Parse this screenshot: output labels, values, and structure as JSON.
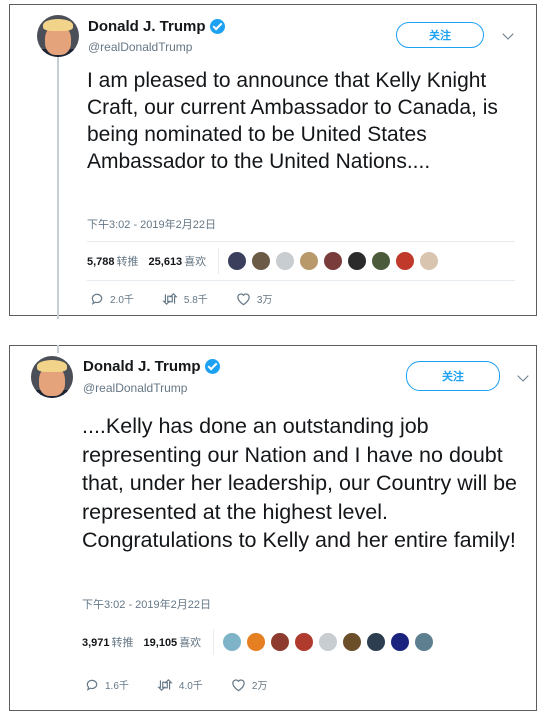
{
  "tweets": [
    {
      "name": "Donald J. Trump",
      "handle": "@realDonaldTrump",
      "follow_label": "关注",
      "text": "I am pleased to announce that Kelly Knight Craft, our current Ambassador to Canada, is being nominated to be United States Ambassador to the United Nations....",
      "timestamp": "下午3:02 - 2019年2月22日",
      "retweets": {
        "count": "5,788",
        "label": "转推"
      },
      "likes": {
        "count": "25,613",
        "label": "喜欢"
      },
      "reply_count": "2.0千",
      "retweet_count_short": "5.8千",
      "like_count_short": "3万",
      "liker_colors": [
        "#3b3f5c",
        "#6b5a46",
        "#c8cdd2",
        "#b89a6a",
        "#7a3b3b",
        "#2b2b2b",
        "#4a5a3a",
        "#c0392b",
        "#d9c4b0"
      ]
    },
    {
      "name": "Donald J. Trump",
      "handle": "@realDonaldTrump",
      "follow_label": "关注",
      "text": "....Kelly has done an outstanding job representing our Nation and I have no doubt that, under her leadership, our Country will be represented at the highest level. Congratulations to Kelly and her entire family!",
      "timestamp": "下午3:02 - 2019年2月22日",
      "retweets": {
        "count": "3,971",
        "label": "转推"
      },
      "likes": {
        "count": "19,105",
        "label": "喜欢"
      },
      "reply_count": "1.6千",
      "retweet_count_short": "4.0千",
      "like_count_short": "2万",
      "liker_colors": [
        "#7fb3c8",
        "#e67e22",
        "#8e3b2f",
        "#b03a2e",
        "#c8cdd2",
        "#6b4f2a",
        "#2c3e50",
        "#1a237e",
        "#5d7f8f"
      ]
    }
  ],
  "colors": {
    "accent": "#1da1f2",
    "secondary_text": "#657786"
  },
  "icons": [
    "verified-icon",
    "chevron-down-icon",
    "reply-icon",
    "retweet-icon",
    "like-icon"
  ]
}
